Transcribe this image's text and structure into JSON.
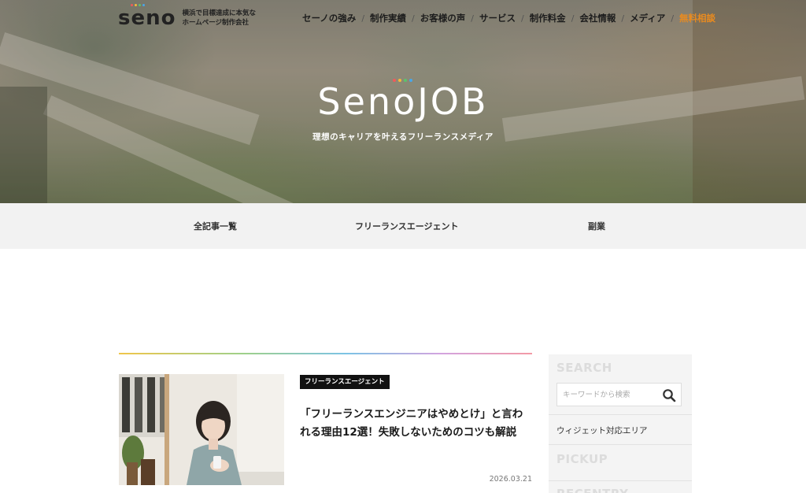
{
  "header": {
    "logo_text": "seno",
    "tagline_line1": "横浜で目標達成に本気な",
    "tagline_line2": "ホームページ制作会社",
    "nav": [
      {
        "label": "セーノの強み"
      },
      {
        "label": "制作実績"
      },
      {
        "label": "お客様の声"
      },
      {
        "label": "サービス"
      },
      {
        "label": "制作料金"
      },
      {
        "label": "会社情報"
      },
      {
        "label": "メディア"
      },
      {
        "label": "無料相談"
      }
    ],
    "nav_separator": "/",
    "accent_color": "#e98b1f"
  },
  "hero": {
    "brand": "SenoJOB",
    "subtitle": "理想のキャリアを叶えるフリーランスメディア",
    "brand_dot_colors": [
      "#f05a5a",
      "#f5b73a",
      "#5cc36b",
      "#4aa6e8"
    ]
  },
  "categories": [
    {
      "label": "全記事一覧"
    },
    {
      "label": "フリーランスエージェント"
    },
    {
      "label": "副業"
    }
  ],
  "post": {
    "category_badge": "フリーランスエージェント",
    "title": "「フリーランスエンジニアはやめとけ」と言われる理由12選！失敗しないためのコツも解説",
    "date": "2026.03.21"
  },
  "sidebar": {
    "search_heading": "SEARCH",
    "search_placeholder": "キーワードから検索",
    "widget_text": "ウィジェット対応エリア",
    "pickup_heading": "PICKUP",
    "recently_heading": "RECENTRY"
  }
}
